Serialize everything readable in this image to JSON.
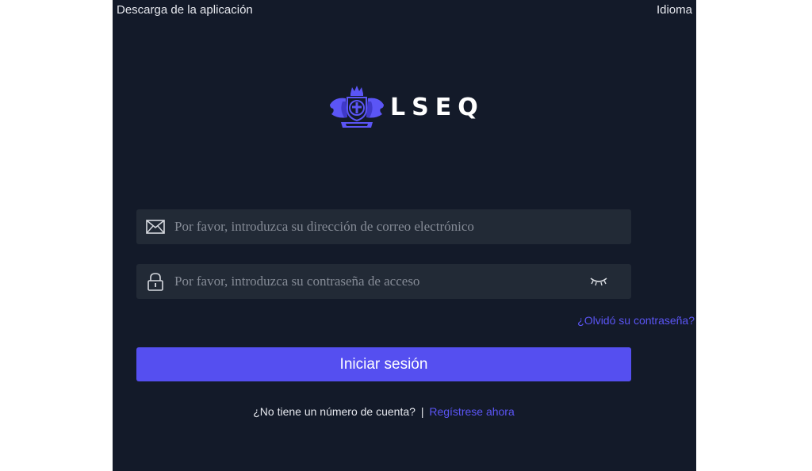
{
  "header": {
    "app_download": "Descarga de la aplicación",
    "language": "Idioma"
  },
  "brand": {
    "name": "LSEQ",
    "logo_color": "#5b55f5"
  },
  "form": {
    "email_placeholder": "Por favor, introduzca su dirección de correo electrónico",
    "email_value": "",
    "password_placeholder": "Por favor, introduzca su contraseña de acceso",
    "password_value": "",
    "forgot_password": "¿Olvidó su contraseña?",
    "login_button": "Iniciar sesión"
  },
  "register": {
    "prompt": "¿No tiene un número de cuenta?",
    "separator": "|",
    "link": "Regístrese ahora"
  },
  "icons": {
    "email": "envelope-icon",
    "password": "lock-icon",
    "toggle": "eye-closed-icon"
  },
  "colors": {
    "background": "#131a29",
    "field": "#222a36",
    "accent": "#554ff0",
    "link": "#5b55f5"
  }
}
